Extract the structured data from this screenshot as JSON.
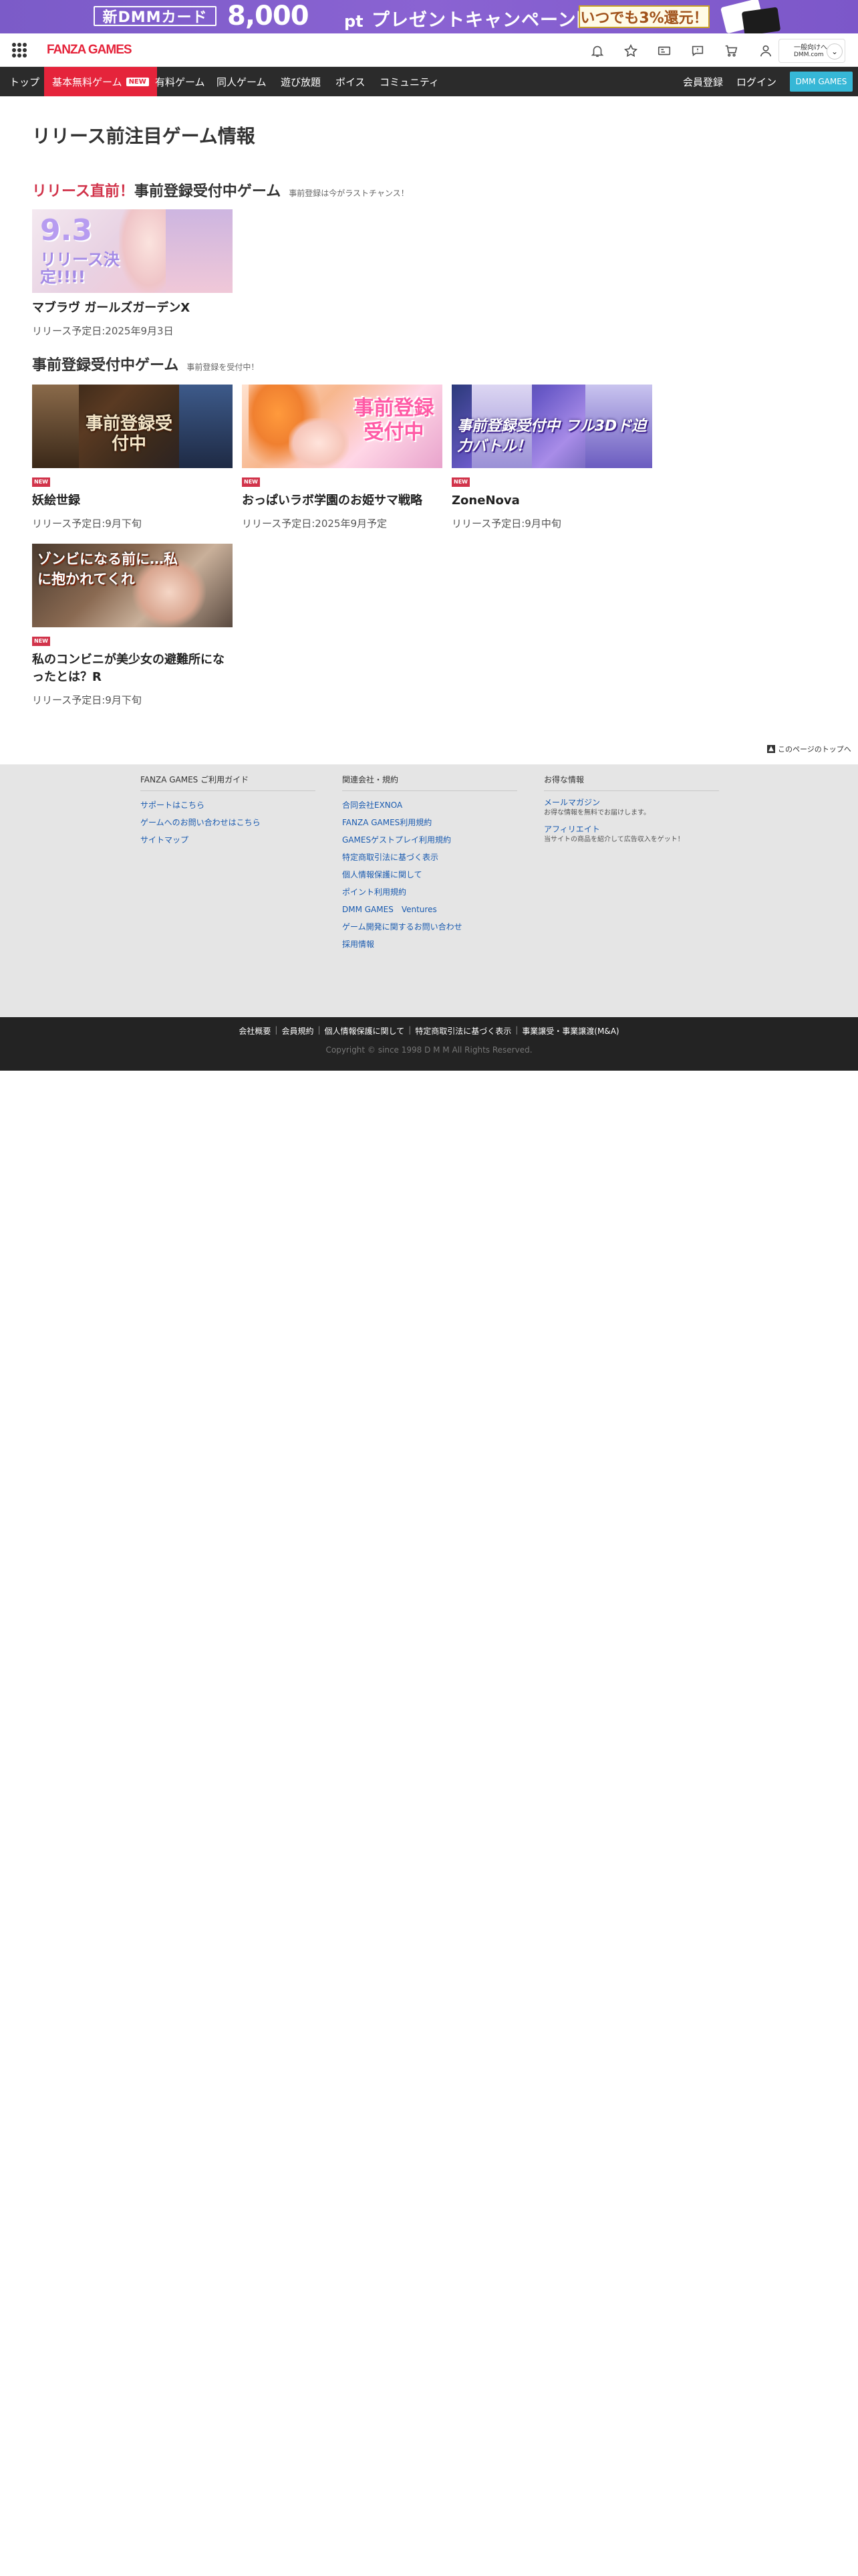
{
  "banner": {
    "card_label": "新DMMカード",
    "amount": "8,000",
    "unit": "pt",
    "campaign": "プレゼントキャンペーン開催中！",
    "cashback": "いつでも3%還元！"
  },
  "header": {
    "logo": "FANZA GAMES",
    "account_line1": "一般向けへ",
    "account_line2": "DMM.com"
  },
  "nav": {
    "items": [
      "トップ",
      "基本無料ゲーム",
      "有料ゲーム",
      "同人ゲーム",
      "遊び放題",
      "ボイス",
      "コミュニティ"
    ],
    "new_badge": "NEW",
    "register": "会員登録",
    "login": "ログイン",
    "dmm_games": "DMM GAMES"
  },
  "main": {
    "page_title": "リリース前注目ゲーム情報",
    "section1": {
      "title_red": "リリース直前！",
      "title": "事前登録受付中ゲーム",
      "sub": "事前登録は今がラストチャンス！",
      "games": [
        {
          "thumb_text1": "9.3",
          "thumb_text2": "リリース決定!!!!",
          "name": "マブラヴ ガールズガーデンX",
          "release": "リリース予定日:2025年9月3日"
        }
      ]
    },
    "section2": {
      "title": "事前登録受付中ゲーム",
      "sub": "事前登録を受付中！",
      "games": [
        {
          "thumb_text": "事前登録受付中",
          "badge": "NEW",
          "name": "妖絵世録",
          "release": "リリース予定日:9月下旬"
        },
        {
          "thumb_text": "事前登録受付中",
          "badge": "NEW",
          "name": "おっぱいラボ学園のお姫サマ戦略",
          "release": "リリース予定日:2025年9月予定"
        },
        {
          "thumb_text": "事前登録受付中 フル3Dド迫力バトル！",
          "badge": "NEW",
          "name": "ZoneNova",
          "release": "リリース予定日:9月中旬"
        },
        {
          "thumb_text": "ゾンビになる前に…私に抱かれてくれ",
          "badge": "NEW",
          "name": "私のコンビニが美少女の避難所になったとは？R",
          "release": "リリース予定日:9月下旬"
        }
      ]
    }
  },
  "footer": {
    "page_top": "このページのトップへ",
    "col1": {
      "heading": "FANZA GAMES ご利用ガイド",
      "links": [
        "サポートはこちら",
        "ゲームへのお問い合わせはこちら",
        "サイトマップ"
      ]
    },
    "col2": {
      "heading": "関連会社・規約",
      "links": [
        "合同会社EXNOA",
        "FANZA GAMES利用規約",
        "GAMESゲストプレイ利用規約",
        "特定商取引法に基づく表示",
        "個人情報保護に関して",
        "ポイント利用規約",
        "DMM GAMES　Ventures",
        "ゲーム開発に関するお問い合わせ",
        "採用情報"
      ]
    },
    "col3": {
      "heading": "お得な情報",
      "items": [
        {
          "link": "メールマガジン",
          "desc": "お得な情報を無料でお届けします。"
        },
        {
          "link": "アフィリエイト",
          "desc": "当サイトの商品を紹介して広告収入をゲット！"
        }
      ]
    },
    "bottom_links": [
      "会社概要",
      "会員規約",
      "個人情報保護に関して",
      "特定商取引法に基づく表示",
      "事業譲受・事業譲渡(M&A)"
    ],
    "copyright": "Copyright © since 1998 D M M All Rights Reserved."
  }
}
